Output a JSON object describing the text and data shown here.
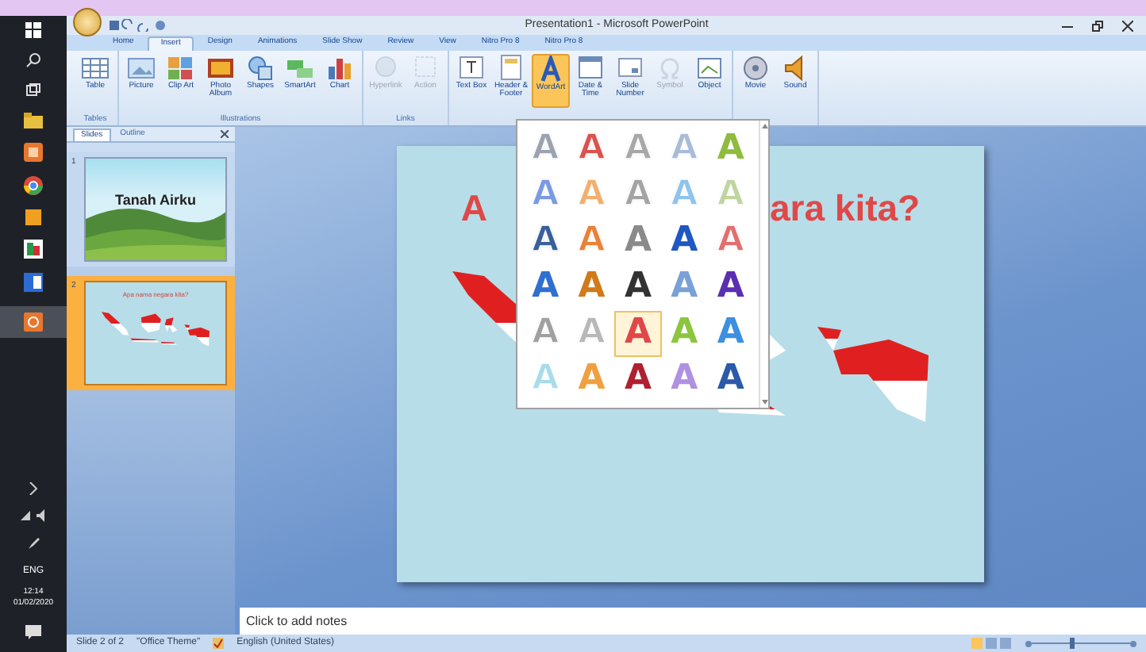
{
  "window": {
    "title": "Presentation1 - Microsoft PowerPoint"
  },
  "taskbar": {
    "language": "ENG",
    "time": "12:14",
    "date": "01/02/2020"
  },
  "ribbon_tabs": [
    {
      "label": "Home",
      "selected": false
    },
    {
      "label": "Insert",
      "selected": true
    },
    {
      "label": "Design",
      "selected": false
    },
    {
      "label": "Animations",
      "selected": false
    },
    {
      "label": "Slide Show",
      "selected": false
    },
    {
      "label": "Review",
      "selected": false
    },
    {
      "label": "View",
      "selected": false
    },
    {
      "label": "Nitro Pro 8",
      "selected": false
    },
    {
      "label": "Nitro Pro 8",
      "selected": false
    }
  ],
  "ribbon_groups": [
    {
      "label": "Tables",
      "buttons": [
        {
          "label": "Table",
          "disabled": false,
          "selected": false
        }
      ]
    },
    {
      "label": "Illustrations",
      "buttons": [
        {
          "label": "Picture",
          "disabled": false,
          "selected": false
        },
        {
          "label": "Clip Art",
          "disabled": false,
          "selected": false
        },
        {
          "label": "Photo Album",
          "disabled": false,
          "selected": false
        },
        {
          "label": "Shapes",
          "disabled": false,
          "selected": false
        },
        {
          "label": "SmartArt",
          "disabled": false,
          "selected": false
        },
        {
          "label": "Chart",
          "disabled": false,
          "selected": false
        }
      ]
    },
    {
      "label": "Links",
      "buttons": [
        {
          "label": "Hyperlink",
          "disabled": true,
          "selected": false
        },
        {
          "label": "Action",
          "disabled": true,
          "selected": false
        }
      ]
    },
    {
      "buttons": [
        {
          "label": "Text Box",
          "disabled": false,
          "selected": false
        },
        {
          "label": "Header & Footer",
          "disabled": false,
          "selected": false
        },
        {
          "label": "WordArt",
          "disabled": false,
          "selected": true
        },
        {
          "label": "Date & Time",
          "disabled": false,
          "selected": false
        },
        {
          "label": "Slide Number",
          "disabled": false,
          "selected": false
        },
        {
          "label": "Symbol",
          "disabled": true,
          "selected": false
        },
        {
          "label": "Object",
          "disabled": false,
          "selected": false
        }
      ]
    },
    {
      "buttons": [
        {
          "label": "Movie",
          "disabled": false,
          "selected": false
        },
        {
          "label": "Sound",
          "disabled": false,
          "selected": false
        }
      ]
    }
  ],
  "panel_tabs": [
    {
      "label": "Slides",
      "selected": true
    },
    {
      "label": "Outline",
      "selected": false
    }
  ],
  "slides": [
    {
      "number": "1",
      "title": "Tanah Airku",
      "kind": "landscape",
      "selected": false
    },
    {
      "number": "2",
      "title": "Apa nama negara kita?",
      "kind": "map",
      "selected": true
    }
  ],
  "slide": {
    "title_parts": [
      "A",
      "ara kita?"
    ]
  },
  "wordart_gallery": {
    "items": [
      {
        "label": "A",
        "color": "#9ca3af",
        "kind": "outline",
        "selected": false
      },
      {
        "label": "A",
        "color": "#d9534f",
        "kind": "outline",
        "selected": false
      },
      {
        "label": "A",
        "color": "#a8a8a8",
        "kind": "outline",
        "selected": false
      },
      {
        "label": "A",
        "color": "#a8bcd8",
        "kind": "outline",
        "selected": false
      },
      {
        "label": "A",
        "color": "#8fbc3f",
        "kind": "fill",
        "selected": false
      },
      {
        "label": "A",
        "color": "#7b9be0",
        "kind": "outline",
        "selected": false
      },
      {
        "label": "A",
        "color": "#f0b070",
        "kind": "outline",
        "selected": false
      },
      {
        "label": "A",
        "color": "#a4a4a4",
        "kind": "outline",
        "selected": false
      },
      {
        "label": "A",
        "color": "#8fc4ec",
        "kind": "outline",
        "selected": false
      },
      {
        "label": "A",
        "color": "#c0d4a0",
        "kind": "outline",
        "selected": false
      },
      {
        "label": "A",
        "color": "#3a5f9a",
        "kind": "outline",
        "selected": false
      },
      {
        "label": "A",
        "color": "#e8823a",
        "kind": "outline",
        "selected": false
      },
      {
        "label": "A",
        "color": "#8a8a8a",
        "kind": "fill",
        "selected": false
      },
      {
        "label": "A",
        "color": "#1f57c3",
        "kind": "fill",
        "selected": false
      },
      {
        "label": "A",
        "color": "#e07070",
        "kind": "outline",
        "selected": false
      },
      {
        "label": "A",
        "color": "#2f6fd0",
        "kind": "fill",
        "selected": false
      },
      {
        "label": "A",
        "color": "#d07a1a",
        "kind": "fill",
        "selected": false
      },
      {
        "label": "A",
        "color": "#333333",
        "kind": "fill",
        "selected": false
      },
      {
        "label": "A",
        "color": "#7aa0d8",
        "kind": "fill",
        "selected": false
      },
      {
        "label": "A",
        "color": "#5a2fb0",
        "kind": "fill",
        "selected": false
      },
      {
        "label": "A",
        "color": "#a0a0a0",
        "kind": "outline",
        "selected": false
      },
      {
        "label": "A",
        "color": "#b8b8b8",
        "kind": "outline",
        "selected": false
      },
      {
        "label": "A",
        "color": "#e04848",
        "kind": "fill",
        "selected": true
      },
      {
        "label": "A",
        "color": "#8cc63f",
        "kind": "fill",
        "selected": false
      },
      {
        "label": "A",
        "color": "#3d8fe0",
        "kind": "fill",
        "selected": false
      },
      {
        "label": "A",
        "color": "#a8dce8",
        "kind": "outline",
        "selected": false
      },
      {
        "label": "A",
        "color": "#f0a040",
        "kind": "fill",
        "selected": false
      },
      {
        "label": "A",
        "color": "#b02030",
        "kind": "fill",
        "selected": false
      },
      {
        "label": "A",
        "color": "#b090e0",
        "kind": "fill",
        "selected": false
      },
      {
        "label": "A",
        "color": "#2a5aa8",
        "kind": "fill",
        "selected": false
      }
    ]
  },
  "notes": {
    "placeholder": "Click to add notes"
  },
  "status_bar": {
    "slide": "Slide 2 of 2",
    "theme": "\"Office Theme\"",
    "language": "English (United States)",
    "zoom": {
      "level": 0.4
    }
  }
}
